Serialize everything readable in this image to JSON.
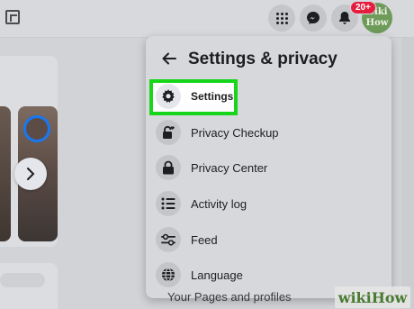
{
  "topbar": {
    "notification_count": "20+",
    "avatar_text_line1": "wiki",
    "avatar_text_line2": "How"
  },
  "menu": {
    "title": "Settings & privacy",
    "items": [
      {
        "label": "Settings",
        "icon": "gear-icon"
      },
      {
        "label": "Privacy Checkup",
        "icon": "lock-heart-icon"
      },
      {
        "label": "Privacy Center",
        "icon": "lock-icon"
      },
      {
        "label": "Activity log",
        "icon": "list-icon"
      },
      {
        "label": "Feed",
        "icon": "sliders-icon"
      },
      {
        "label": "Language",
        "icon": "globe-icon"
      }
    ]
  },
  "background": {
    "partial_text": "Your Pages and profiles"
  },
  "watermark": {
    "brand": "wikiHow"
  },
  "colors": {
    "highlight": "#17d61a",
    "badge": "#e41e3f",
    "story_ring": "#1877f2"
  }
}
